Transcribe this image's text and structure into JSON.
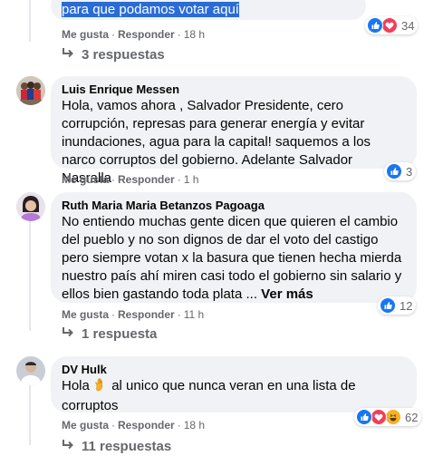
{
  "comments": [
    {
      "text_partial": "para que podamos votar aquí",
      "actions": {
        "like": "Me gusta",
        "reply": "Responder",
        "time": "18 h"
      },
      "reaction_count": "34",
      "replies_label": "3 respuestas"
    },
    {
      "author": "Luis Enrique Messen",
      "text": "Hola, vamos ahora , Salvador Presidente, cero corrupción, represas para generar energía y evitar inundaciones, agua para la capital! saquemos a los narco corruptos del gobierno. Adelante Salvador Nasralla",
      "actions": {
        "like": "Me gusta",
        "reply": "Responder",
        "time": "1 h"
      },
      "reaction_count": "3"
    },
    {
      "author": "Ruth Maria Maria Betanzos Pagoaga",
      "text": "No entiendo muchas gente dicen que quieren el cambio del pueblo y no son dignos de dar el voto del castigo pero siempre votan x la basura que tienen hecha mierda nuestro país ahí miren casi todo el gobierno sin salario y ellos bien gastando toda plata ...",
      "see_more": "Ver más",
      "actions": {
        "like": "Me gusta",
        "reply": "Responder",
        "time": "11 h"
      },
      "reaction_count": "12",
      "replies_label": "1 respuesta"
    },
    {
      "author": "DV Hulk",
      "text_before": "Hola",
      "text_after": "al unico que nunca veran en una lista de corruptos",
      "actions": {
        "like": "Me gusta",
        "reply": "Responder",
        "time": "18 h"
      },
      "reaction_count": "62",
      "replies_label": "11 respuestas"
    }
  ],
  "colors": {
    "like_blue": "#1877f2",
    "love_red": "#f33e58",
    "haha_yellow": "#f7b125",
    "bubble": "#f0f2f5",
    "meta_grey": "#65676b"
  }
}
